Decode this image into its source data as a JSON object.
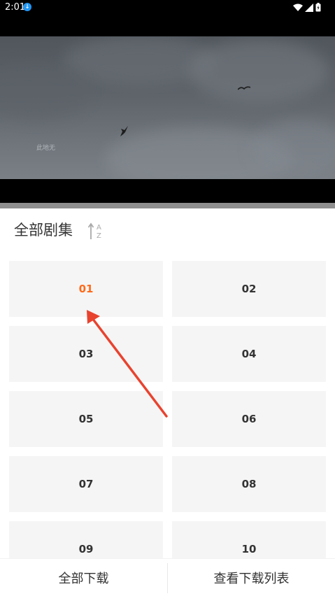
{
  "status_bar": {
    "time": "2:01",
    "app_icon": "download-app-icon",
    "icons": [
      "wifi-icon",
      "signal-icon",
      "battery-icon"
    ]
  },
  "video": {
    "watermark": "此地无",
    "scene": "sky-with-birds"
  },
  "panel": {
    "title": "全部剧集",
    "sort_icon": "sort-az-icon"
  },
  "episodes": [
    {
      "label": "01",
      "active": true
    },
    {
      "label": "02",
      "active": false
    },
    {
      "label": "03",
      "active": false
    },
    {
      "label": "04",
      "active": false
    },
    {
      "label": "05",
      "active": false
    },
    {
      "label": "06",
      "active": false
    },
    {
      "label": "07",
      "active": false
    },
    {
      "label": "08",
      "active": false
    },
    {
      "label": "09",
      "active": false
    },
    {
      "label": "10",
      "active": false
    }
  ],
  "bottom_bar": {
    "download_all": "全部下载",
    "view_list": "查看下载列表"
  },
  "colors": {
    "accent": "#ff6a1a",
    "annotation_arrow": "#e8432f",
    "cell_bg": "#f5f5f5"
  }
}
